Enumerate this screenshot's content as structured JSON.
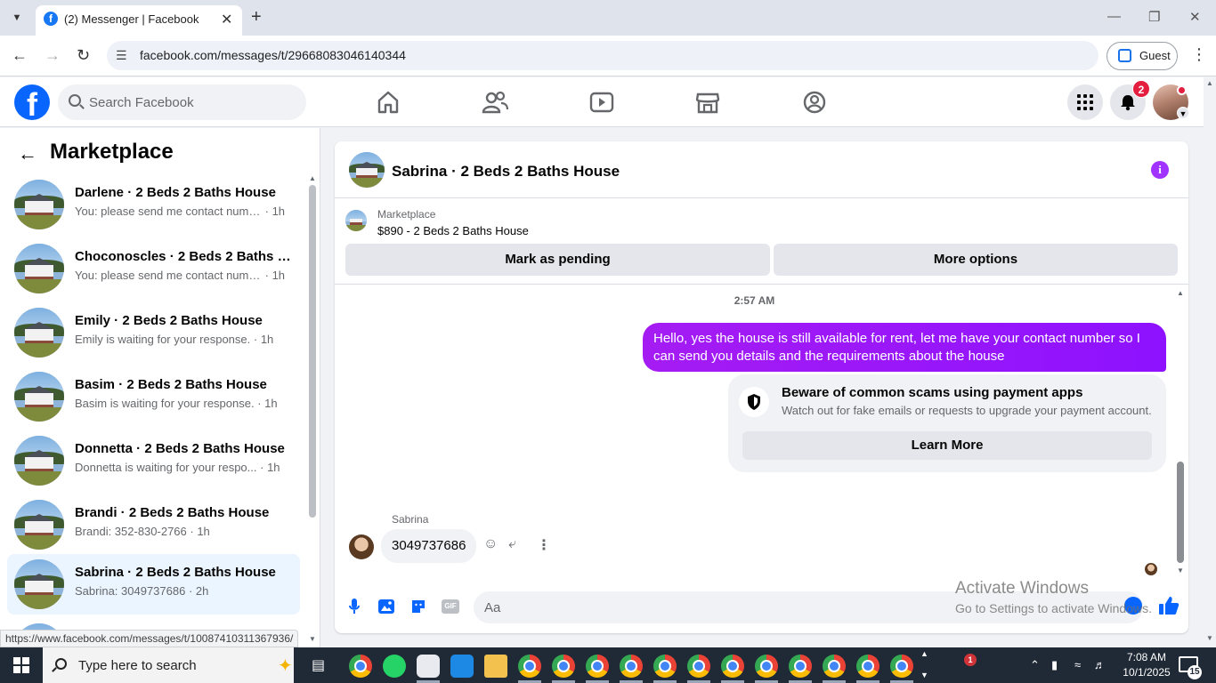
{
  "browser": {
    "tab_title": "(2) Messenger | Facebook",
    "url": "facebook.com/messages/t/29668083046140344",
    "profile_label": "Guest",
    "status_url": "https://www.facebook.com/messages/t/10087410311367936/"
  },
  "fb_header": {
    "search_placeholder": "Search Facebook",
    "notification_count": "2",
    "logo_letter": "f"
  },
  "left_panel": {
    "title": "Marketplace",
    "conversations": [
      {
        "name": "Darlene · 2 Beds 2 Baths House",
        "preview": "You: please send me contact number",
        "time": "1h",
        "active": false
      },
      {
        "name": "Choconoscles · 2 Beds 2 Baths H...",
        "preview": "You: please send me contact number",
        "time": "1h",
        "active": false
      },
      {
        "name": "Emily · 2 Beds 2 Baths House",
        "preview": "Emily is waiting for your response.",
        "time": "1h",
        "active": false
      },
      {
        "name": "Basim · 2 Beds 2 Baths House",
        "preview": "Basim is waiting for your response.",
        "time": "1h",
        "active": false
      },
      {
        "name": "Donnetta · 2 Beds 2 Baths House",
        "preview": "Donnetta is waiting for your respo...",
        "time": "1h",
        "active": false
      },
      {
        "name": "Brandi · 2 Beds 2 Baths House",
        "preview": "Brandi: 352-830-2766",
        "time": "1h",
        "active": false
      },
      {
        "name": "Sabrina · 2 Beds 2 Baths House",
        "preview": "Sabrina: 3049737686",
        "time": "2h",
        "active": true
      }
    ]
  },
  "chat": {
    "title": "Sabrina · 2 Beds 2 Baths House",
    "listing": {
      "label": "Marketplace",
      "price_title": "$890 - 2 Beds 2 Baths House",
      "mark_pending_label": "Mark as pending",
      "more_options_label": "More options"
    },
    "timestamp": "2:57 AM",
    "outgoing_message": "Hello, yes the house is still available for rent, let me have your contact number so I can send you details and the requirements about the house",
    "scam_warning": {
      "title": "Beware of common scams using payment apps",
      "description": "Watch out for fake emails or requests to upgrade your payment account.",
      "button_label": "Learn More"
    },
    "incoming_sender": "Sabrina",
    "incoming_message": "3049737686",
    "composer_placeholder": "Aa"
  },
  "watermark": {
    "title": "Activate Windows",
    "subtitle": "Go to Settings to activate Windows."
  },
  "taskbar": {
    "search_placeholder": "Type here to search",
    "time": "7:08 AM",
    "date": "10/1/2025",
    "notification_badge": "15",
    "app_badge": "1"
  },
  "colors": {
    "facebook_blue": "#0866ff",
    "message_purple": "#a033ff",
    "active_conversation": "#ebf5ff",
    "notification_red": "#e41e3f"
  }
}
